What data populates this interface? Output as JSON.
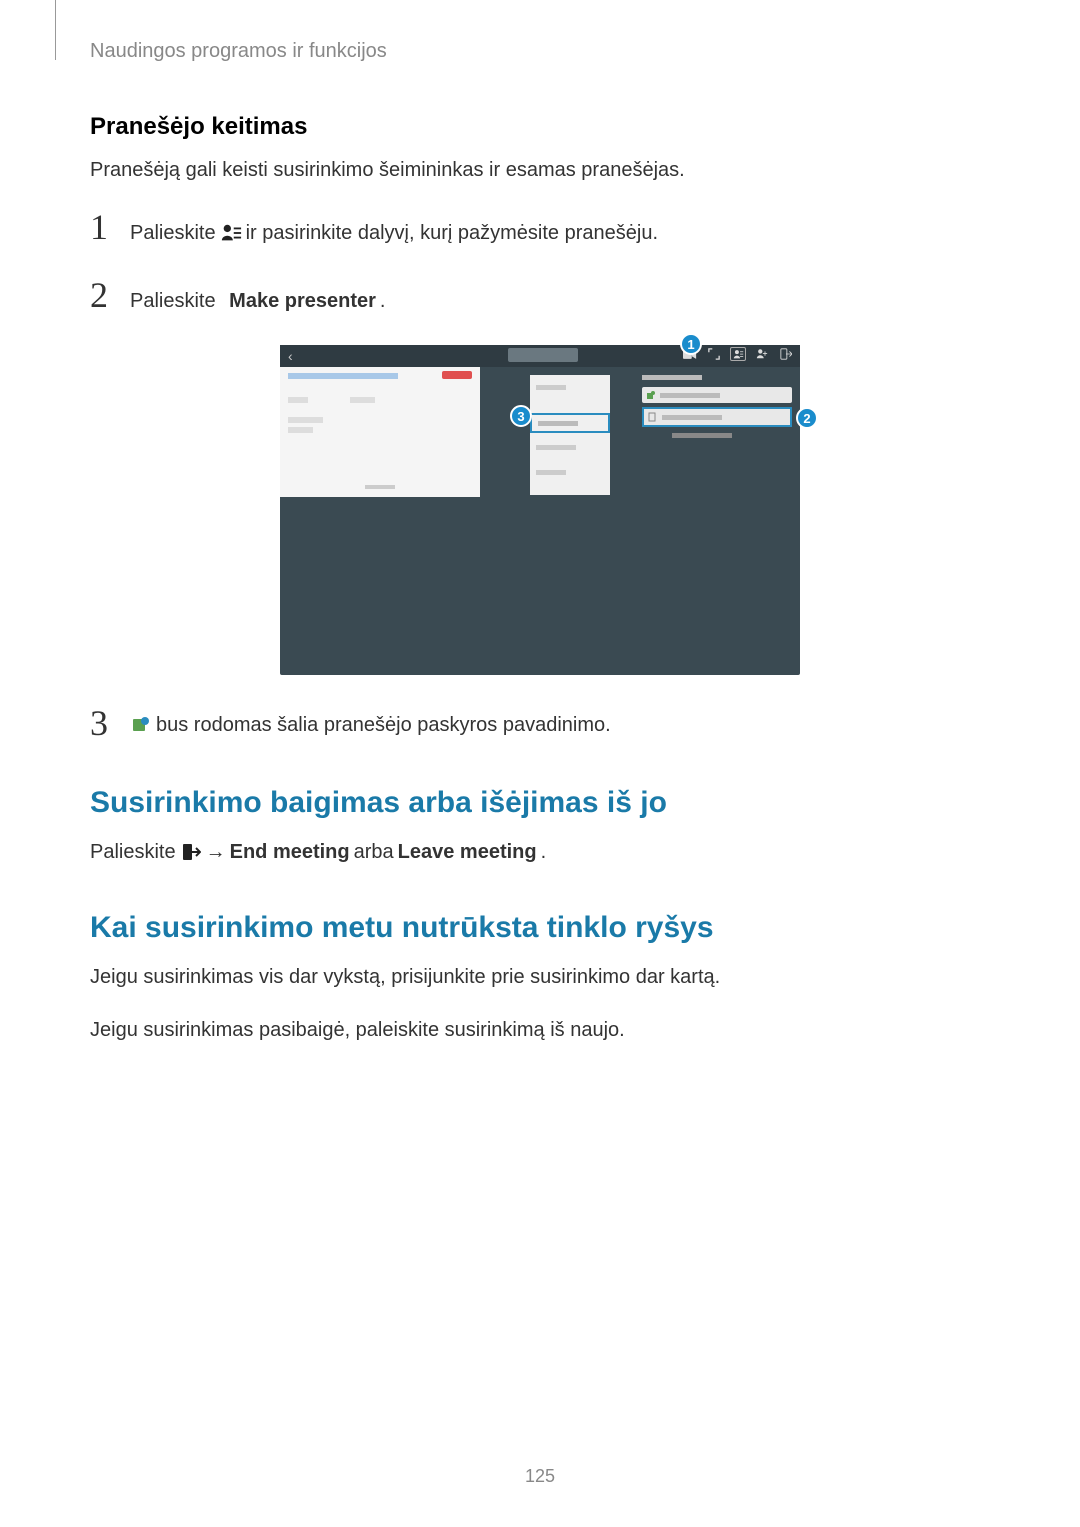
{
  "header": "Naudingos programos ir funkcijos",
  "sub1": {
    "title": "Pranešėjo keitimas",
    "intro": "Pranešėją gali keisti susirinkimo šeimininkas ir esamas pranešėjas.",
    "step1_a": "Palieskite",
    "step1_b": "ir pasirinkite dalyvį, kurį pažymėsite pranešėju.",
    "step2_a": "Palieskite",
    "step2_b": "Make presenter",
    "step2_c": ".",
    "step3": "bus rodomas šalia pranešėjo paskyros pavadinimo."
  },
  "callouts": {
    "c1": "1",
    "c2": "2",
    "c3": "3"
  },
  "section2": {
    "title": "Susirinkimo baigimas arba išėjimas iš jo",
    "line_a": "Palieskite",
    "arrow": "→",
    "bold1": "End meeting",
    "mid": "arba",
    "bold2": "Leave meeting",
    "end": "."
  },
  "section3": {
    "title": "Kai susirinkimo metu nutrūksta tinklo ryšys",
    "p1": "Jeigu susirinkimas vis dar vykstą, prisijunkite prie susirinkimo dar kartą.",
    "p2": "Jeigu susirinkimas pasibaigė, paleiskite susirinkimą iš naujo."
  },
  "page_number": "125"
}
